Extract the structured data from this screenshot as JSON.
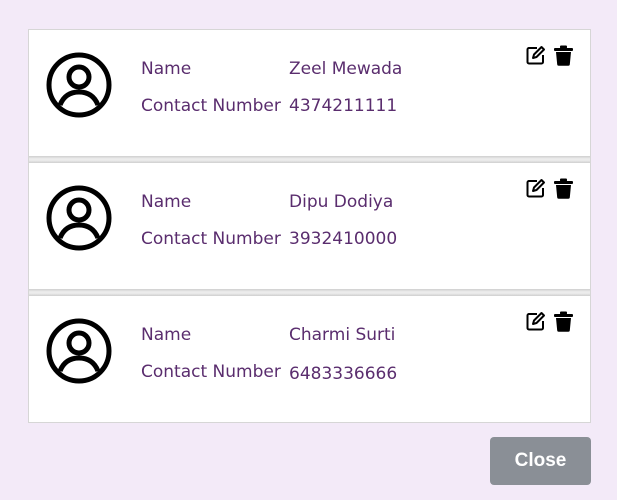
{
  "contacts": [
    {
      "name_label": "Name",
      "name": "Zeel Mewada",
      "phone_label": "Contact Number",
      "phone": "4374211111",
      "avatar_icon": "user-circle-icon",
      "edit_icon": "edit-icon",
      "delete_icon": "trash-icon"
    },
    {
      "name_label": "Name",
      "name": "Dipu Dodiya",
      "phone_label": "Contact Number",
      "phone": "3932410000",
      "avatar_icon": "user-circle-icon",
      "edit_icon": "edit-icon",
      "delete_icon": "trash-icon"
    },
    {
      "name_label": "Name",
      "name": "Charmi Surti",
      "phone_label": "Contact Number",
      "phone": "6483336666",
      "avatar_icon": "user-circle-icon",
      "edit_icon": "edit-icon",
      "delete_icon": "trash-icon"
    }
  ],
  "footer": {
    "close_label": "Close"
  },
  "colors": {
    "background": "#f3eaf8",
    "text": "#5a2d6e",
    "close_button": "#8a8f96"
  }
}
